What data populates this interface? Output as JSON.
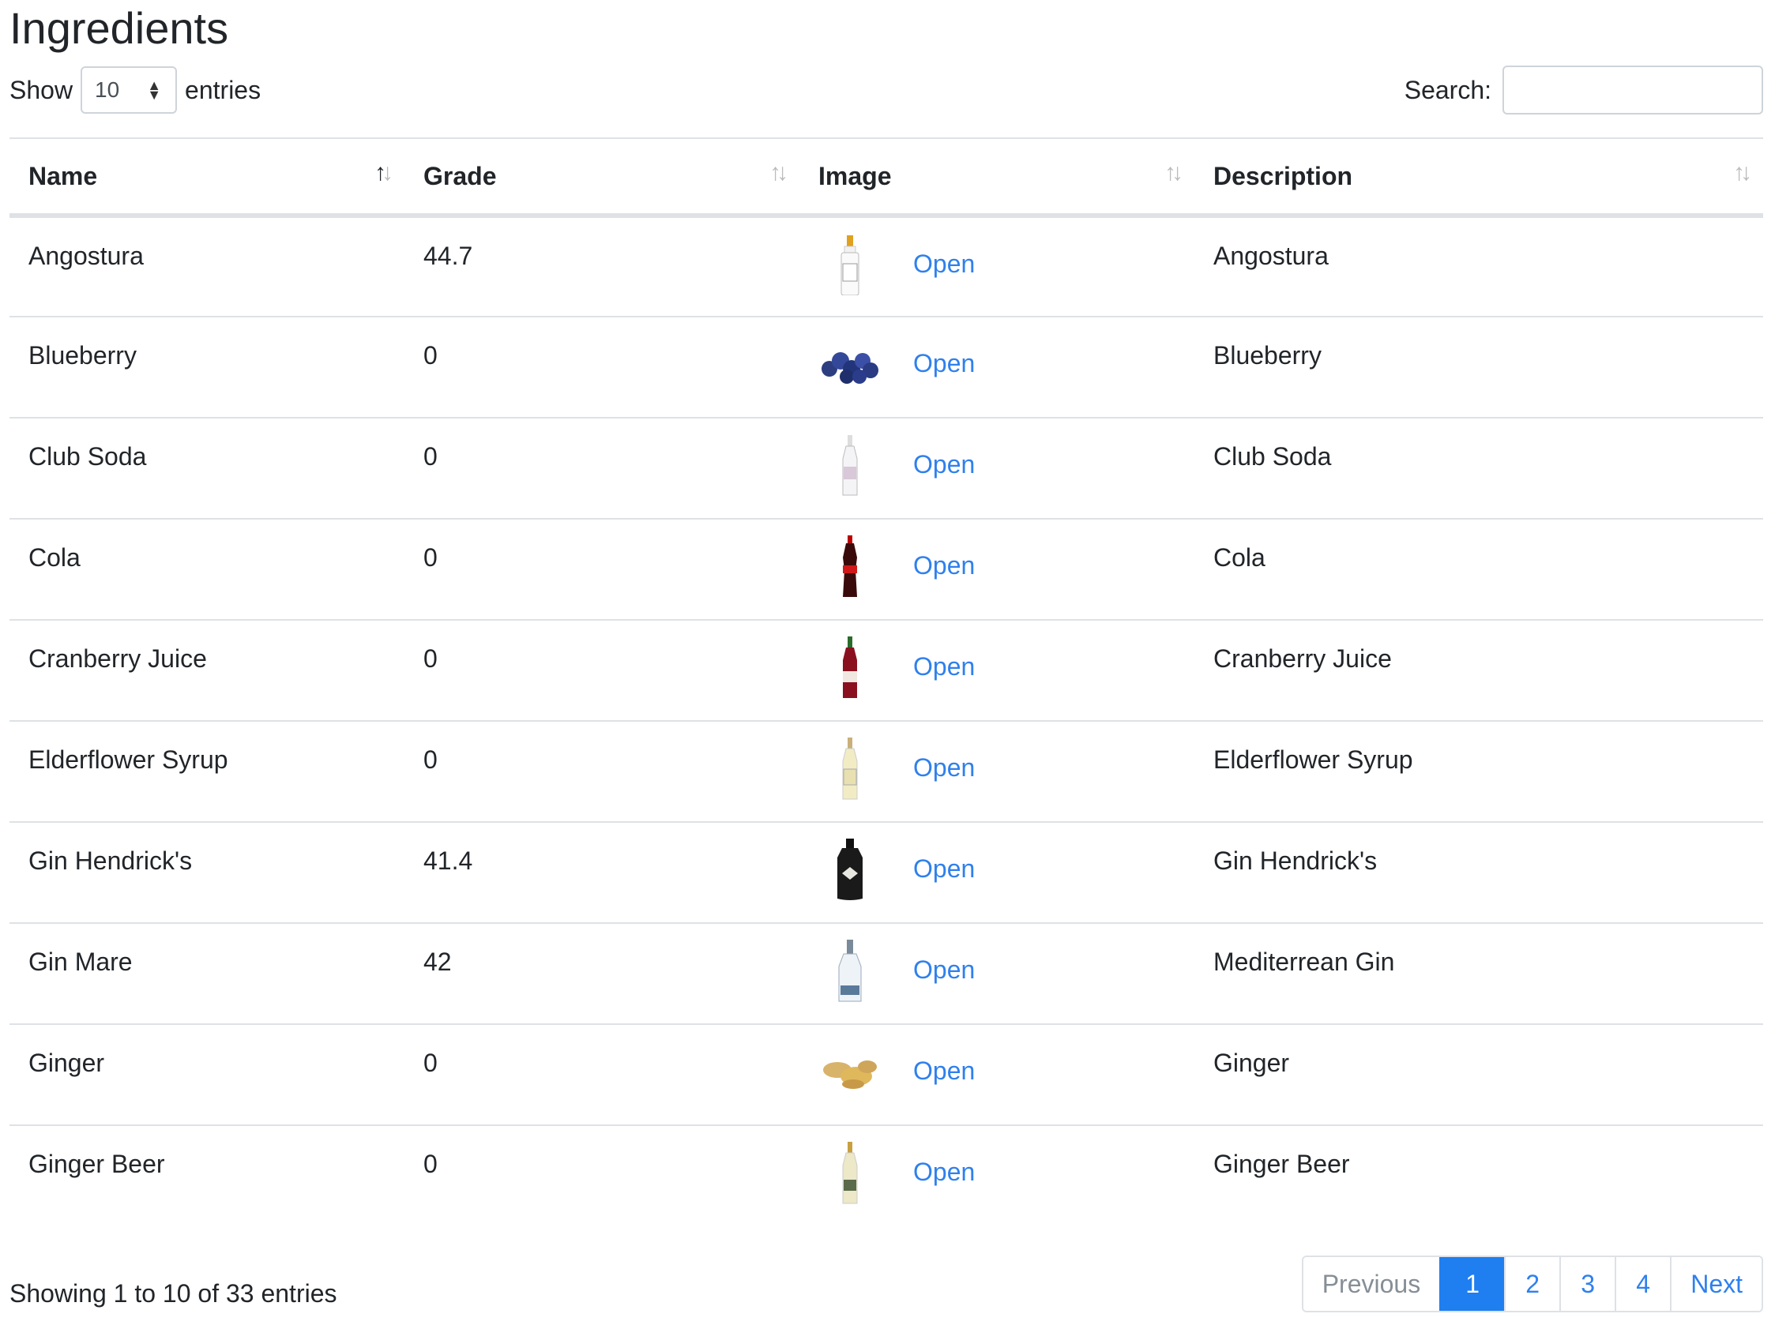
{
  "page": {
    "title": "Ingredients"
  },
  "controls": {
    "show_label": "Show",
    "entries_value": "10",
    "entries_label": "entries",
    "search_label": "Search:",
    "search_value": ""
  },
  "table": {
    "columns": [
      "Name",
      "Grade",
      "Image",
      "Description"
    ],
    "sort_column": "Name",
    "open_label": "Open",
    "rows": [
      {
        "name": "Angostura",
        "grade": "44.7",
        "image": "bitters-bottle",
        "description": "Angostura"
      },
      {
        "name": "Blueberry",
        "grade": "0",
        "image": "blueberries",
        "description": "Blueberry"
      },
      {
        "name": "Club Soda",
        "grade": "0",
        "image": "soda-bottle",
        "description": "Club Soda"
      },
      {
        "name": "Cola",
        "grade": "0",
        "image": "cola-bottle",
        "description": "Cola"
      },
      {
        "name": "Cranberry Juice",
        "grade": "0",
        "image": "juice-bottle",
        "description": "Cranberry Juice"
      },
      {
        "name": "Elderflower Syrup",
        "grade": "0",
        "image": "syrup-bottle",
        "description": "Elderflower Syrup"
      },
      {
        "name": "Gin Hendrick's",
        "grade": "41.4",
        "image": "hendricks-bottle",
        "description": "Gin Hendrick's"
      },
      {
        "name": "Gin Mare",
        "grade": "42",
        "image": "gin-mare-bottle",
        "description": "Mediterrean Gin"
      },
      {
        "name": "Ginger",
        "grade": "0",
        "image": "ginger-root",
        "description": "Ginger"
      },
      {
        "name": "Ginger Beer",
        "grade": "0",
        "image": "ginger-beer-bottle",
        "description": "Ginger Beer"
      }
    ]
  },
  "footer": {
    "info": "Showing 1 to 10 of 33 entries",
    "previous": "Previous",
    "pages": [
      "1",
      "2",
      "3",
      "4"
    ],
    "current_page": "1",
    "next": "Next"
  },
  "colors": {
    "link": "#2f80ed",
    "active_page": "#1f7ef0"
  }
}
